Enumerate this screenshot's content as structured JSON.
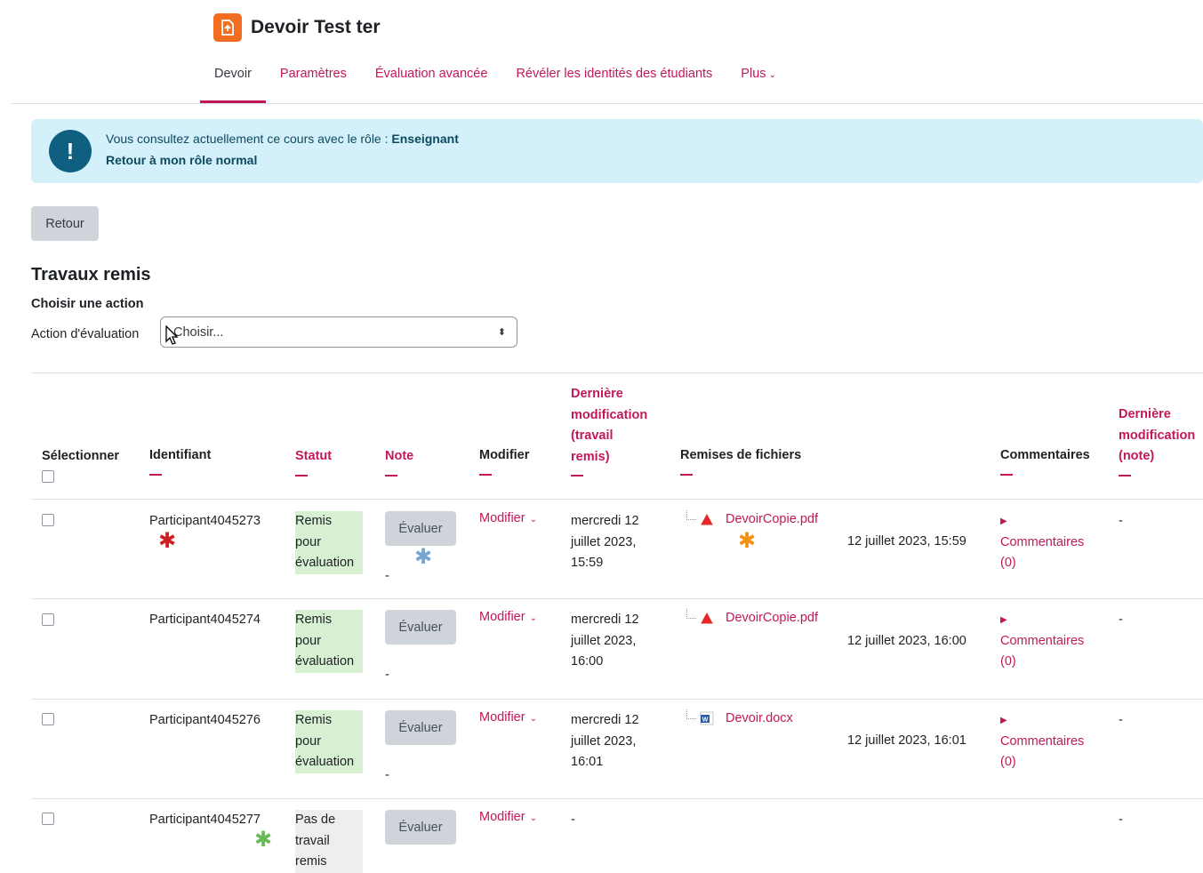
{
  "page": {
    "title": "Devoir Test ter",
    "logo_icon": "assignment-icon"
  },
  "nav": {
    "tabs": [
      {
        "label": "Devoir",
        "active": true
      },
      {
        "label": "Paramètres"
      },
      {
        "label": "Évaluation avancée"
      },
      {
        "label": "Révéler les identités des étudiants"
      },
      {
        "label": "Plus"
      }
    ]
  },
  "alert": {
    "text": "Vous consultez actuellement ce cours avec le rôle : ",
    "role": "Enseignant",
    "link": "Retour à mon rôle normal"
  },
  "back_button": "Retour",
  "section": {
    "title": "Travaux remis",
    "choose_action": "Choisir une action",
    "action_label": "Action d'évaluation",
    "select_placeholder": "Choisir..."
  },
  "table": {
    "headers": {
      "select": "Sélectionner",
      "identifiant": "Identifiant",
      "statut": "Statut",
      "note": "Note",
      "modifier": "Modifier",
      "last_mod_work_1": "Dernière",
      "last_mod_work_2": "modification",
      "last_mod_work_3": "(travail",
      "last_mod_work_4": "remis)",
      "files": "Remises de fichiers",
      "comments": "Commentaires",
      "last_mod_note_1": "Dernière",
      "last_mod_note_2": "modification",
      "last_mod_note_3": "(note)"
    },
    "rows": [
      {
        "id": "Participant4045273",
        "status_1": "Remis",
        "status_2": "pour",
        "status_3": "évaluation",
        "grade_button": "Évaluer",
        "grade_value": "-",
        "modify": "Modifier",
        "date_1": "mercredi 12",
        "date_2": "juillet 2023,",
        "date_3": "15:59",
        "file": "DevoirCopie.pdf",
        "file_type": "pdf",
        "file_date": "12 juillet 2023, 15:59",
        "comments_1": "Commentaires",
        "comments_2": "(0)",
        "last_note": "-"
      },
      {
        "id": "Participant4045274",
        "status_1": "Remis",
        "status_2": "pour",
        "status_3": "évaluation",
        "grade_button": "Évaluer",
        "grade_value": "-",
        "modify": "Modifier",
        "date_1": "mercredi 12",
        "date_2": "juillet 2023,",
        "date_3": "16:00",
        "file": "DevoirCopie.pdf",
        "file_type": "pdf",
        "file_date": "12 juillet 2023, 16:00",
        "comments_1": "Commentaires",
        "comments_2": "(0)",
        "last_note": "-"
      },
      {
        "id": "Participant4045276",
        "status_1": "Remis",
        "status_2": "pour",
        "status_3": "évaluation",
        "grade_button": "Évaluer",
        "grade_value": "-",
        "modify": "Modifier",
        "date_1": "mercredi 12",
        "date_2": "juillet 2023,",
        "date_3": "16:01",
        "file": "Devoir.docx",
        "file_type": "docx",
        "file_date": "12 juillet 2023, 16:01",
        "comments_1": "Commentaires",
        "comments_2": "(0)",
        "last_note": "-"
      },
      {
        "id": "Participant4045277",
        "status_1": "Pas de",
        "status_2": "travail",
        "status_3": "remis",
        "grade_button": "Évaluer",
        "modify": "Modifier",
        "date_1": "-",
        "last_note": "-"
      }
    ]
  },
  "colors": {
    "accent": "#c2185b",
    "alert_bg": "#d4f0fa",
    "submitted_bg": "#d7f0d2",
    "not_submitted_bg": "#eeeeee"
  }
}
